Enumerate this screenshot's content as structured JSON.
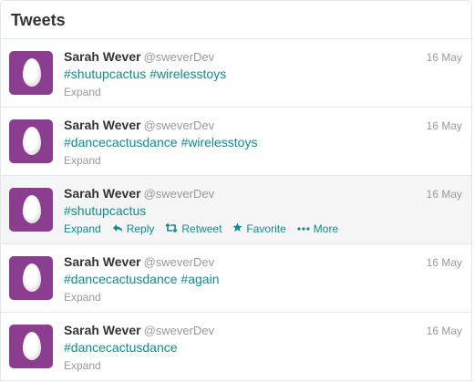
{
  "panel": {
    "title": "Tweets"
  },
  "colors": {
    "accent": "#0f8c8f",
    "avatar_bg": "#8b3d8f",
    "meta_gray": "#999999",
    "hover_bg": "#f5f5f5"
  },
  "tweets": [
    {
      "name": "Sarah Wever",
      "handle": "@sweverDev",
      "date": "16 May",
      "hashtags": [
        "#shutupcactus",
        "#wirelesstoys"
      ],
      "expand": "Expand"
    },
    {
      "name": "Sarah Wever",
      "handle": "@sweverDev",
      "date": "16 May",
      "hashtags": [
        "#dancecactusdance",
        "#wirelesstoys"
      ],
      "expand": "Expand"
    },
    {
      "name": "Sarah Wever",
      "handle": "@sweverDev",
      "date": "16 May",
      "hashtags": [
        "#shutupcactus"
      ],
      "expand": "Expand",
      "hovered": true,
      "actions": {
        "reply": "Reply",
        "retweet": "Retweet",
        "favorite": "Favorite",
        "more": "More"
      }
    },
    {
      "name": "Sarah Wever",
      "handle": "@sweverDev",
      "date": "16 May",
      "hashtags": [
        "#dancecactusdance",
        "#again"
      ],
      "expand": "Expand"
    },
    {
      "name": "Sarah Wever",
      "handle": "@sweverDev",
      "date": "16 May",
      "hashtags": [
        "#dancecactusdance"
      ],
      "expand": "Expand"
    }
  ],
  "icons": {
    "avatar": "egg-avatar-icon",
    "reply": "reply-arrow-icon",
    "retweet": "retweet-icon",
    "favorite": "star-icon",
    "more": "more-dots-icon"
  }
}
